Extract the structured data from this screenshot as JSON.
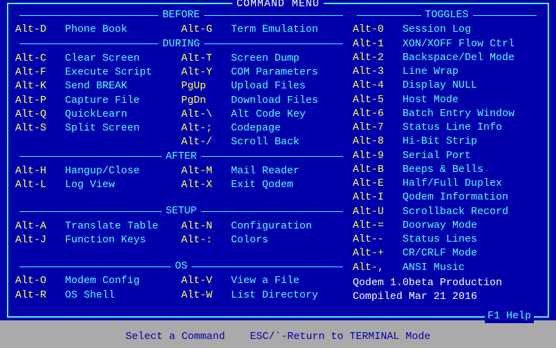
{
  "title": "COMMAND MENU",
  "f1help": "F1 Help",
  "status": {
    "left": "Select a Command",
    "right": "ESC/`-Return to TERMINAL Mode"
  },
  "left_sections": {
    "before": {
      "label": "BEFORE",
      "rows": [
        [
          {
            "key": "Alt-D",
            "desc": "Phone Book"
          },
          {
            "key": "Alt-G",
            "desc": "Term Emulation"
          }
        ]
      ]
    },
    "during": {
      "label": "DURING",
      "rows": [
        [
          {
            "key": "Alt-C",
            "desc": "Clear Screen"
          },
          {
            "key": "Alt-T",
            "desc": "Screen Dump"
          }
        ],
        [
          {
            "key": "Alt-F",
            "desc": "Execute Script"
          },
          {
            "key": "Alt-Y",
            "desc": "COM Parameters"
          }
        ],
        [
          {
            "key": "Alt-K",
            "desc": "Send BREAK"
          },
          {
            "key": "PgUp",
            "desc": "Upload Files"
          }
        ],
        [
          {
            "key": "Alt-P",
            "desc": "Capture File"
          },
          {
            "key": "PgDn",
            "desc": "Download Files"
          }
        ],
        [
          {
            "key": "Alt-Q",
            "desc": "QuickLearn"
          },
          {
            "key": "Alt-\\",
            "desc": "Alt Code Key"
          }
        ],
        [
          {
            "key": "Alt-S",
            "desc": "Split Screen"
          },
          {
            "key": "Alt-;",
            "desc": "Codepage"
          }
        ],
        [
          {
            "key": "",
            "desc": ""
          },
          {
            "key": "Alt-/",
            "desc": "Scroll Back"
          }
        ]
      ]
    },
    "after": {
      "label": "AFTER",
      "rows": [
        [
          {
            "key": "Alt-H",
            "desc": "Hangup/Close"
          },
          {
            "key": "Alt-M",
            "desc": "Mail Reader"
          }
        ],
        [
          {
            "key": "Alt-L",
            "desc": "Log View"
          },
          {
            "key": "Alt-X",
            "desc": "Exit Qodem"
          }
        ]
      ]
    },
    "setup": {
      "label": "SETUP",
      "rows": [
        [
          {
            "key": "Alt-A",
            "desc": "Translate Table"
          },
          {
            "key": "Alt-N",
            "desc": "Configuration"
          }
        ],
        [
          {
            "key": "Alt-J",
            "desc": "Function Keys"
          },
          {
            "key": "Alt-:",
            "desc": "Colors"
          }
        ]
      ]
    },
    "os": {
      "label": "OS",
      "rows": [
        [
          {
            "key": "Alt-O",
            "desc": "Modem Config"
          },
          {
            "key": "Alt-V",
            "desc": "View a File"
          }
        ],
        [
          {
            "key": "Alt-R",
            "desc": "OS Shell"
          },
          {
            "key": "Alt-W",
            "desc": "List Directory"
          }
        ]
      ]
    }
  },
  "toggles": {
    "label": "TOGGLES",
    "rows": [
      {
        "key": "Alt-0",
        "desc": "Session Log"
      },
      {
        "key": "Alt-1",
        "desc": "XON/XOFF Flow Ctrl"
      },
      {
        "key": "Alt-2",
        "desc": "Backspace/Del Mode"
      },
      {
        "key": "Alt-3",
        "desc": "Line Wrap"
      },
      {
        "key": "Alt-4",
        "desc": "Display NULL"
      },
      {
        "key": "Alt-5",
        "desc": "Host Mode"
      },
      {
        "key": "Alt-6",
        "desc": "Batch Entry Window"
      },
      {
        "key": "Alt-7",
        "desc": "Status Line Info"
      },
      {
        "key": "Alt-8",
        "desc": "Hi-Bit Strip"
      },
      {
        "key": "Alt-9",
        "desc": "Serial Port"
      },
      {
        "key": "Alt-B",
        "desc": "Beeps & Bells"
      },
      {
        "key": "Alt-E",
        "desc": "Half/Full Duplex"
      },
      {
        "key": "Alt-I",
        "desc": "Qodem Information"
      },
      {
        "key": "Alt-U",
        "desc": "Scrollback Record"
      },
      {
        "key": "Alt-=",
        "desc": "Doorway Mode"
      },
      {
        "key": "Alt--",
        "desc": "Status Lines"
      },
      {
        "key": "Alt-+",
        "desc": "CR/CRLF Mode"
      },
      {
        "key": "Alt-,",
        "desc": "ANSI Music"
      }
    ]
  },
  "version": {
    "line1": "Qodem 1.0beta Production",
    "line2": "Compiled Mar 21 2016"
  }
}
